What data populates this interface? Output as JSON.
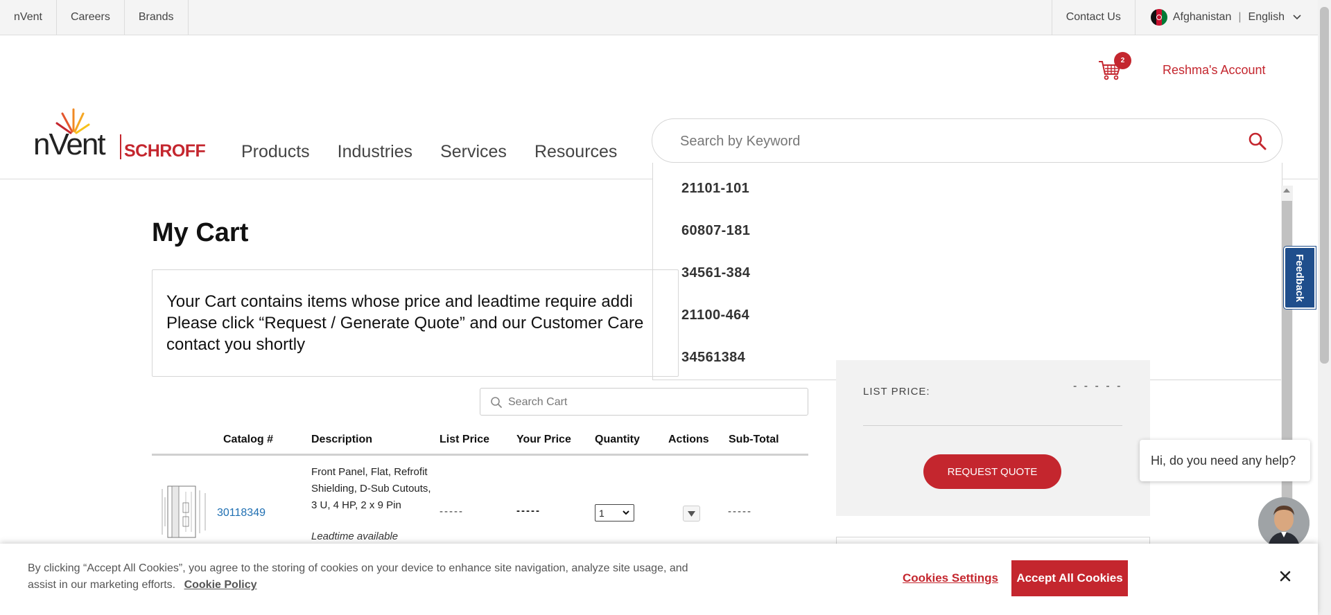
{
  "util_nav": {
    "left": [
      "nVent",
      "Careers",
      "Brands"
    ],
    "contact": "Contact Us",
    "country": "Afghanistan",
    "separator": "|",
    "language": "English"
  },
  "header": {
    "cart_count": "2",
    "account": "Reshma's Account",
    "logo_brand": "nVent",
    "logo_sub": "SCHROFF",
    "nav": [
      "Products",
      "Industries",
      "Services",
      "Resources"
    ]
  },
  "search": {
    "placeholder": "Search by Keyword",
    "suggestions": [
      "21101-101",
      "60807-181",
      "34561-384",
      "21100-464",
      "34561384"
    ]
  },
  "cart": {
    "title": "My Cart",
    "notice_lines": [
      "Your Cart contains items whose price and leadtime require addi",
      "Please click “Request / Generate Quote” and our Customer Care",
      "contact you shortly"
    ],
    "search_placeholder": "Search Cart",
    "columns": [
      "Catalog #",
      "Description",
      "List Price",
      "Your Price",
      "Quantity",
      "Actions",
      "Sub-Total"
    ],
    "rows": [
      {
        "catalog": "30118349",
        "description": "Front Panel, Flat, Refrofit Shielding, D-Sub Cutouts, 3 U, 4 HP, 2 x 9 Pin",
        "leadtime": "Leadtime available",
        "list_price": "-----",
        "your_price": "-----",
        "quantity": "1",
        "subtotal": "-----"
      }
    ]
  },
  "summary": {
    "list_price_label": "LIST PRICE:",
    "list_price_value": "- - - - -",
    "request_quote": "REQUEST QUOTE"
  },
  "widgets": {
    "feedback": "Feedback",
    "chat_greeting": "Hi, do you need any help?"
  },
  "cookie": {
    "text": "By clicking “Accept All Cookies”, you agree to the storing of cookies on your device to enhance site navigation, analyze site usage, and assist in our marketing efforts.",
    "policy": "Cookie Policy",
    "settings": "Cookies Settings",
    "accept": "Accept All Cookies"
  },
  "colors": {
    "brand_red": "#c4262e",
    "link_blue": "#1f6fb2",
    "feedback_blue": "#1f4e8c"
  }
}
